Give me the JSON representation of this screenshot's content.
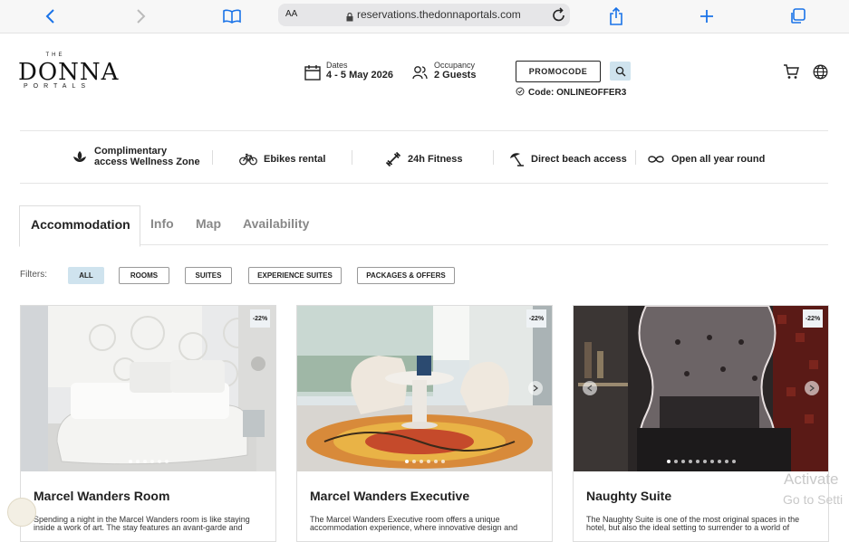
{
  "browser": {
    "aa_label": "AA",
    "url": "reservations.thedonnaportals.com"
  },
  "logo": {
    "the": "THE",
    "main": "DONNA",
    "sub": "PORTALS"
  },
  "header": {
    "dates_label": "Dates",
    "dates_value": "4 - 5 May 2026",
    "occupancy_label": "Occupancy",
    "occupancy_value": "2 Guests",
    "promo_button": "PROMOCODE",
    "promo_code": "Code: ONLINEOFFER3"
  },
  "amenities": [
    {
      "line1": "Complimentary",
      "line2": "access Wellness Zone",
      "icon": "lotus-icon"
    },
    {
      "label": "Ebikes rental",
      "icon": "bicycle-icon"
    },
    {
      "label": "24h Fitness",
      "icon": "dumbbell-icon"
    },
    {
      "label": "Direct beach access",
      "icon": "umbrella-icon"
    },
    {
      "label": "Open all year round",
      "icon": "infinity-icon"
    }
  ],
  "tabs": [
    {
      "label": "Accommodation",
      "active": true
    },
    {
      "label": "Info"
    },
    {
      "label": "Map"
    },
    {
      "label": "Availability"
    }
  ],
  "filters": {
    "label": "Filters:",
    "chips": [
      "ALL",
      "ROOMS",
      "SUITES",
      "EXPERIENCE SUITES",
      "PACKAGES & OFFERS"
    ]
  },
  "cards": [
    {
      "badge": "-22%",
      "title": "Marcel Wanders Room",
      "desc": "Spending a night in the Marcel Wanders room is like staying inside a work of art. The stay features an avant-garde and"
    },
    {
      "badge": "-22%",
      "title": "Marcel Wanders Executive",
      "desc": "The Marcel Wanders Executive room offers a unique accommodation experience, where innovative design and"
    },
    {
      "badge": "-22%",
      "title": "Naughty Suite",
      "desc": "The Naughty Suite is one of the most original spaces in the hotel, but also the ideal setting to surrender to a world of"
    }
  ],
  "os_watermark": {
    "line1": "Activate",
    "line2": "Go to Setti"
  },
  "colors": {
    "chip_active": "#cfe3ee",
    "accent": "#1a73e8"
  }
}
